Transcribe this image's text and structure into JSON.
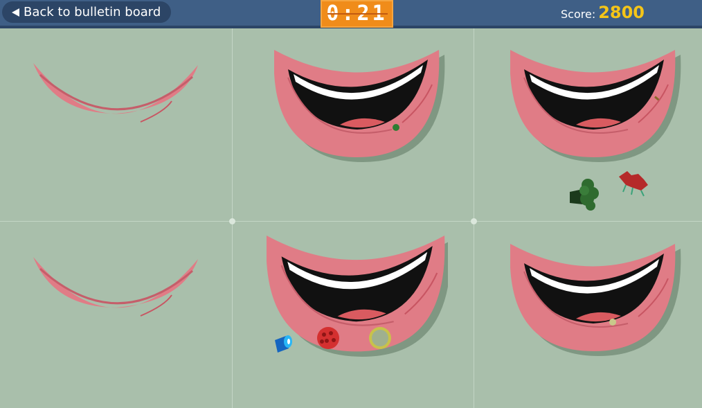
{
  "header": {
    "back_label": "Back to bulletin board",
    "timer": "0:21",
    "score_label": "Score:",
    "score_value": "2800"
  },
  "colors": {
    "background": "#a9bfab",
    "header": "#3f5f86",
    "timer": "#f08c1a",
    "score": "#f5c518",
    "lips": "#e07c86"
  },
  "mouths": [
    {
      "name": "mouth-closed-top-left",
      "state": "closed"
    },
    {
      "name": "mouth-open-top-center",
      "state": "open",
      "items": [
        "broccoli-crumb"
      ]
    },
    {
      "name": "mouth-open-top-right",
      "state": "open",
      "items": [
        "crumb"
      ]
    },
    {
      "name": "mouth-closed-bottom-left",
      "state": "closed"
    },
    {
      "name": "mouth-open-bottom-center",
      "state": "open",
      "items": [
        "berry-food",
        "cookie-food"
      ]
    },
    {
      "name": "mouth-open-bottom-right",
      "state": "open",
      "items": [
        "crumb"
      ]
    }
  ],
  "loose_items": [
    "broccoli-food",
    "strawberry-food",
    "toothpaste-tube"
  ]
}
